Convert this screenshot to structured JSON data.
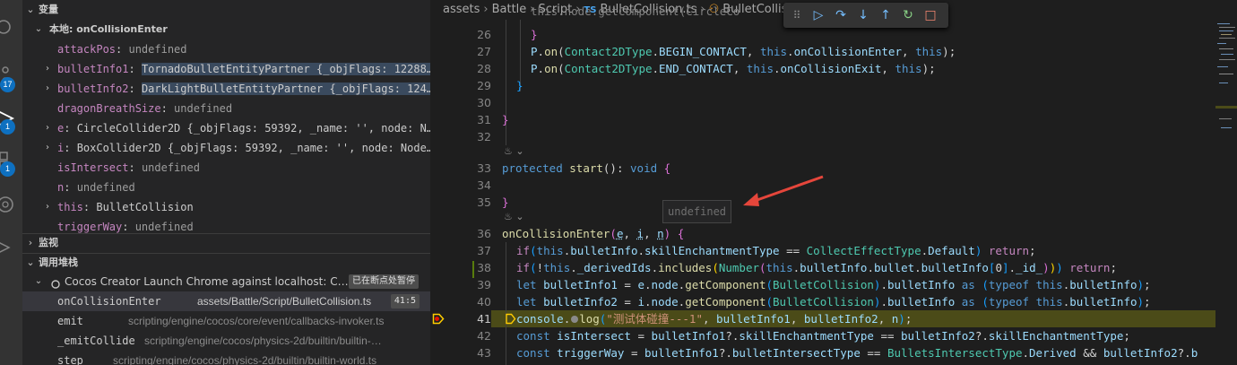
{
  "activity_bar": {
    "icons": [
      "search-icon",
      "source-control-icon",
      "run-debug-icon",
      "extensions-icon",
      "openai-icon",
      "cocos-icon"
    ],
    "badges": {
      "source_control": "17",
      "debug": "1",
      "extensions": "1"
    }
  },
  "variables": {
    "section_title": "变量",
    "scope_title": "本地: onCollisionEnter",
    "items": [
      {
        "name": "attackPos",
        "value": "undefined"
      },
      {
        "name": "bulletInfo1",
        "value": "TornadoBulletEntityPartner {_objFlags: 12288…"
      },
      {
        "name": "bulletInfo2",
        "value": "DarkLightBulletEntityPartner {_objFlags: 124…"
      },
      {
        "name": "dragonBreathSize",
        "value": "undefined"
      },
      {
        "name": "e",
        "value": "CircleCollider2D {_objFlags: 59392, _name: '', node: N…"
      },
      {
        "name": "i",
        "value": "BoxCollider2D {_objFlags: 59392, _name: '', node: Node…"
      },
      {
        "name": "isIntersect",
        "value": "undefined"
      },
      {
        "name": "n",
        "value": "undefined"
      },
      {
        "name": "this",
        "value": "BulletCollision"
      },
      {
        "name": "triggerWay",
        "value": "undefined"
      }
    ]
  },
  "watch": {
    "section_title": "监视"
  },
  "callstack": {
    "section_title": "调用堆栈",
    "session": "Cocos Creator Launch Chrome against localhost: C…",
    "session_status": "已在断点处暂停",
    "frames": [
      {
        "fn": "onCollisionEnter",
        "path": "assets/Battle/Script/BulletCollision.ts",
        "pos": "41:5"
      },
      {
        "fn": "emit",
        "path": "scripting/engine/cocos/core/event/callbacks-invoker.ts"
      },
      {
        "fn": "_emitCollide",
        "path": "scripting/engine/cocos/physics-2d/builtin/builtin-…"
      },
      {
        "fn": "step",
        "path": "scripting/engine/cocos/physics-2d/builtin/builtin-world.ts"
      }
    ]
  },
  "breadcrumb": {
    "parts": [
      "assets",
      "Battle",
      "Script"
    ],
    "file_type": "TS",
    "file": "BulletCollision.ts",
    "symbol": "BulletCollision"
  },
  "debug_toolbar": {
    "actions": [
      "drag-handle-icon",
      "continue-icon",
      "step-over-icon",
      "step-into-icon",
      "step-out-icon",
      "restart-icon",
      "stop-icon"
    ]
  },
  "hover_tooltip": {
    "text": "undefined"
  },
  "editor": {
    "lines": [
      {
        "n": "",
        "text": "this.node.getComponent(CircleCo"
      },
      {
        "n": "26",
        "text": "}"
      },
      {
        "n": "27",
        "text": "P.on(Contact2DType.BEGIN_CONTACT, this.onCollisionEnter, this);"
      },
      {
        "n": "28",
        "text": "P.on(Contact2DType.END_CONTACT, this.onCollisionExit, this);"
      },
      {
        "n": "29",
        "text": "}"
      },
      {
        "n": "30",
        "text": ""
      },
      {
        "n": "31",
        "text": "}"
      },
      {
        "n": "32",
        "text": ""
      },
      {
        "n": "33",
        "text": "protected start(): void {"
      },
      {
        "n": "34",
        "text": ""
      },
      {
        "n": "35",
        "text": "}"
      },
      {
        "n": "36",
        "text": "onCollisionEnter(e, i, n) {"
      },
      {
        "n": "37",
        "text": "if(this.bulletInfo.skillEnchantmentType == CollectEffectType.Default) return;"
      },
      {
        "n": "38",
        "text": "if(!this._derivedIds.includes(Number(this.bulletInfo.bullet.bulletInfo[0]._id_))) return;"
      },
      {
        "n": "39",
        "text": "let bulletInfo1 = e.node.getComponent(BulletCollision).bulletInfo as (typeof this.bulletInfo);"
      },
      {
        "n": "40",
        "text": "let bulletInfo2 = i.node.getComponent(BulletCollision).bulletInfo as (typeof this.bulletInfo);"
      },
      {
        "n": "41",
        "text": "console.log(\"测试体碰撞---1\", bulletInfo1, bulletInfo2, n);"
      },
      {
        "n": "42",
        "text": "const isIntersect = bulletInfo1?.skillEnchantmentType == bulletInfo2?.skillEnchantmentType;"
      },
      {
        "n": "43",
        "text": "const triggerWay = bulletInfo1?.bulletIntersectType == BulletsIntersectType.Derived && bulletInfo2?.b"
      }
    ],
    "current_line": "41"
  },
  "colors": {
    "accent": "#0e70c0",
    "current_line_bg": "#4b4b18",
    "arrow": "#e5463b"
  }
}
